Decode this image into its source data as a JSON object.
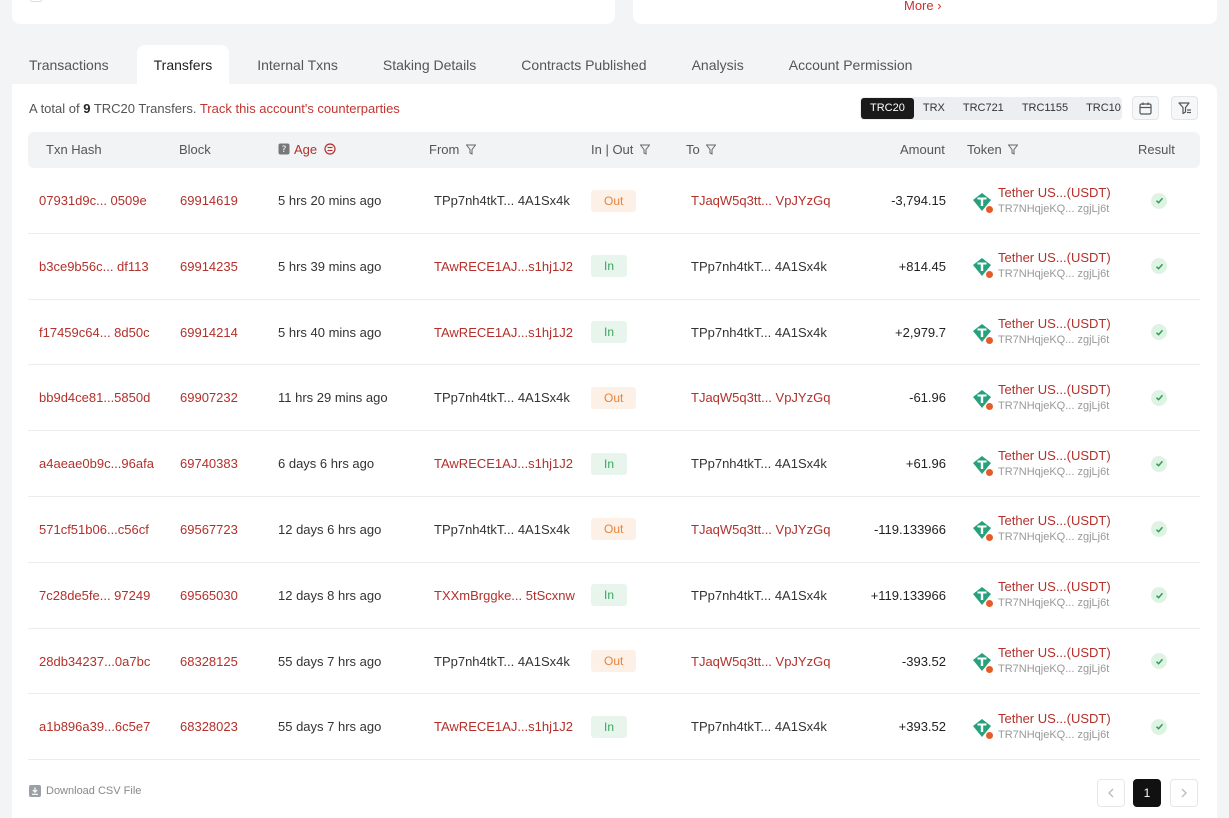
{
  "top": {
    "more_label": "More ›"
  },
  "tabs": [
    {
      "label": "Transactions"
    },
    {
      "label": "Transfers"
    },
    {
      "label": "Internal Txns"
    },
    {
      "label": "Staking Details"
    },
    {
      "label": "Contracts Published"
    },
    {
      "label": "Analysis"
    },
    {
      "label": "Account Permission"
    }
  ],
  "active_tab": "Transfers",
  "summary": {
    "prefix": "A total of",
    "count": "9",
    "suffix": "TRC20 Transfers.",
    "link": "Track this account's counterparties"
  },
  "token_types": [
    "TRC20",
    "TRX",
    "TRC721",
    "TRC1155",
    "TRC10"
  ],
  "active_token_type": "TRC20",
  "columns": {
    "hash": "Txn Hash",
    "block": "Block",
    "age": "Age",
    "from": "From",
    "inout": "In | Out",
    "to": "To",
    "amount": "Amount",
    "token": "Token",
    "result": "Result"
  },
  "rows": [
    {
      "hash": "07931d9c... 0509e",
      "block": "69914619",
      "age": "5 hrs 20 mins ago",
      "from": "TPp7nh4tkT... 4A1Sx4k",
      "dir": "Out",
      "to": "TJaqW5q3tt... VpJYzGq",
      "amount": "-3,794.15",
      "token": "Tether US...(USDT)",
      "token_addr": "TR7NHqjeKQ... zgjLj6t"
    },
    {
      "hash": "b3ce9b56c... df113",
      "block": "69914235",
      "age": "5 hrs 39 mins ago",
      "from": "TAwRECE1AJ...s1hj1J2",
      "dir": "In",
      "to": "TPp7nh4tkT... 4A1Sx4k",
      "amount": "+814.45",
      "token": "Tether US...(USDT)",
      "token_addr": "TR7NHqjeKQ... zgjLj6t"
    },
    {
      "hash": "f17459c64... 8d50c",
      "block": "69914214",
      "age": "5 hrs 40 mins ago",
      "from": "TAwRECE1AJ...s1hj1J2",
      "dir": "In",
      "to": "TPp7nh4tkT... 4A1Sx4k",
      "amount": "+2,979.7",
      "token": "Tether US...(USDT)",
      "token_addr": "TR7NHqjeKQ... zgjLj6t"
    },
    {
      "hash": "bb9d4ce81...5850d",
      "block": "69907232",
      "age": "11 hrs 29 mins ago",
      "from": "TPp7nh4tkT... 4A1Sx4k",
      "dir": "Out",
      "to": "TJaqW5q3tt... VpJYzGq",
      "amount": "-61.96",
      "token": "Tether US...(USDT)",
      "token_addr": "TR7NHqjeKQ... zgjLj6t"
    },
    {
      "hash": "a4aeae0b9c...96afa",
      "block": "69740383",
      "age": "6 days 6 hrs ago",
      "from": "TAwRECE1AJ...s1hj1J2",
      "dir": "In",
      "to": "TPp7nh4tkT... 4A1Sx4k",
      "amount": "+61.96",
      "token": "Tether US...(USDT)",
      "token_addr": "TR7NHqjeKQ... zgjLj6t"
    },
    {
      "hash": "571cf51b06...c56cf",
      "block": "69567723",
      "age": "12 days 6 hrs ago",
      "from": "TPp7nh4tkT... 4A1Sx4k",
      "dir": "Out",
      "to": "TJaqW5q3tt... VpJYzGq",
      "amount": "-119.133966",
      "token": "Tether US...(USDT)",
      "token_addr": "TR7NHqjeKQ... zgjLj6t"
    },
    {
      "hash": "7c28de5fe... 97249",
      "block": "69565030",
      "age": "12 days 8 hrs ago",
      "from": "TXXmBrggke... 5tScxnw",
      "dir": "In",
      "to": "TPp7nh4tkT... 4A1Sx4k",
      "amount": "+119.133966",
      "token": "Tether US...(USDT)",
      "token_addr": "TR7NHqjeKQ... zgjLj6t"
    },
    {
      "hash": "28db34237...0a7bc",
      "block": "68328125",
      "age": "55 days 7 hrs ago",
      "from": "TPp7nh4tkT... 4A1Sx4k",
      "dir": "Out",
      "to": "TJaqW5q3tt... VpJYzGq",
      "amount": "-393.52",
      "token": "Tether US...(USDT)",
      "token_addr": "TR7NHqjeKQ... zgjLj6t"
    },
    {
      "hash": "a1b896a39...6c5e7",
      "block": "68328023",
      "age": "55 days 7 hrs ago",
      "from": "TAwRECE1AJ...s1hj1J2",
      "dir": "In",
      "to": "TPp7nh4tkT... 4A1Sx4k",
      "amount": "+393.52",
      "token": "Tether US...(USDT)",
      "token_addr": "TR7NHqjeKQ... zgjLj6t"
    }
  ],
  "owner_prefix": "TPp7nh4tkT",
  "footer": {
    "csv_label": "Download CSV File",
    "page": "1"
  },
  "colors": {
    "accent": "#b3302b",
    "out": "#e8833a",
    "in": "#3aa55d",
    "tether": "#26a17b"
  },
  "icons": [
    "calendar-icon",
    "filter-icon",
    "funnel-icon",
    "help-icon",
    "sort-icon",
    "check-icon",
    "tether-icon",
    "download-icon",
    "chevron-left-icon",
    "chevron-right-icon"
  ]
}
